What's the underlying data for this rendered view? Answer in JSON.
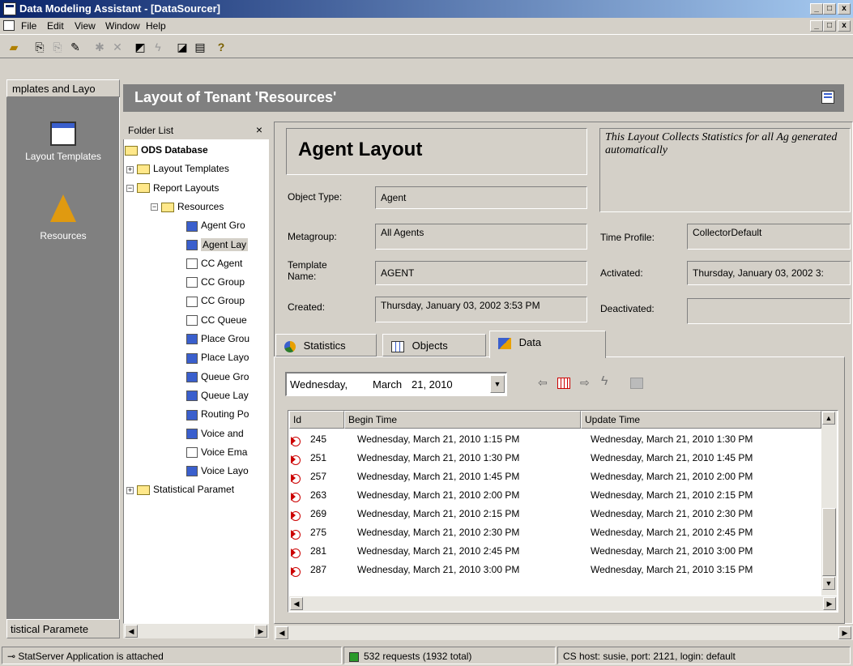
{
  "window": {
    "title": "Data Modeling Assistant - [DataSourcer]",
    "minimize": "_",
    "maximize": "□",
    "close": "x"
  },
  "menu": [
    "File",
    "Edit",
    "View",
    "Window",
    "Help"
  ],
  "left_bar": {
    "top_tab": "mplates and Layo",
    "items": [
      {
        "label": "Layout Templates",
        "icon": "window-icon"
      },
      {
        "label": "Resources",
        "icon": "resources-icon"
      }
    ],
    "bottom_tab": "tistical Paramete"
  },
  "header": {
    "title": "Layout of Tenant 'Resources'"
  },
  "folder_list": {
    "title": "Folder List",
    "close": "×",
    "nodes": [
      {
        "label": "ODS Database",
        "level": 0,
        "bold": true,
        "type": "folder"
      },
      {
        "label": "Layout Templates",
        "level": 1,
        "type": "folder",
        "exp": "+"
      },
      {
        "label": "Report Layouts",
        "level": 1,
        "type": "folder",
        "exp": "−"
      },
      {
        "label": "Resources",
        "level": 2,
        "type": "folder",
        "exp": "−"
      },
      {
        "label": "Agent Gro",
        "level": 3,
        "type": "doc-blue"
      },
      {
        "label": "Agent Lay",
        "level": 3,
        "type": "doc-blue",
        "selected": true
      },
      {
        "label": "CC Agent",
        "level": 3,
        "type": "doc"
      },
      {
        "label": "CC Group",
        "level": 3,
        "type": "doc"
      },
      {
        "label": "CC Group",
        "level": 3,
        "type": "doc"
      },
      {
        "label": "CC Queue",
        "level": 3,
        "type": "doc"
      },
      {
        "label": "Place Grou",
        "level": 3,
        "type": "doc-blue"
      },
      {
        "label": "Place Layo",
        "level": 3,
        "type": "doc-blue"
      },
      {
        "label": "Queue Gro",
        "level": 3,
        "type": "doc-blue"
      },
      {
        "label": "Queue Lay",
        "level": 3,
        "type": "doc-blue"
      },
      {
        "label": "Routing Po",
        "level": 3,
        "type": "doc-blue"
      },
      {
        "label": "Voice and",
        "level": 3,
        "type": "doc-blue"
      },
      {
        "label": "Voice Ema",
        "level": 3,
        "type": "doc"
      },
      {
        "label": "Voice Layo",
        "level": 3,
        "type": "doc-blue"
      },
      {
        "label": "Statistical Paramet",
        "level": 1,
        "type": "folder",
        "exp": "+"
      }
    ]
  },
  "detail": {
    "name": "Agent Layout",
    "description": "This Layout Collects Statistics for all Ag generated automatically",
    "object_type_label": "Object Type:",
    "object_type": "Agent",
    "metagroup_label": "Metagroup:",
    "metagroup": "All Agents",
    "template_label": "Template Name:",
    "template": "AGENT",
    "created_label": "Created:",
    "created": "Thursday, January 03, 2002 3:53 PM",
    "time_profile_label": "Time Profile:",
    "time_profile": "CollectorDefault",
    "activated_label": "Activated:",
    "activated": "Thursday, January 03, 2002 3:",
    "deactivated_label": "Deactivated:",
    "deactivated": ""
  },
  "tabs": [
    {
      "label": "Statistics",
      "icon": "pie-chart-icon"
    },
    {
      "label": "Objects",
      "icon": "grid-icon"
    },
    {
      "label": "Data",
      "icon": "data-icon",
      "active": true
    }
  ],
  "date_picker": {
    "weekday": "Wednesday,",
    "month": "March",
    "day": "21, 2010"
  },
  "grid": {
    "columns": [
      "Id",
      "Begin Time",
      "Update Time"
    ],
    "rows": [
      {
        "id": "245",
        "begin": "Wednesday, March 21, 2010 1:15 PM",
        "update": "Wednesday, March 21, 2010 1:30 PM"
      },
      {
        "id": "251",
        "begin": "Wednesday, March 21, 2010 1:30 PM",
        "update": "Wednesday, March 21, 2010 1:45 PM"
      },
      {
        "id": "257",
        "begin": "Wednesday, March 21, 2010 1:45 PM",
        "update": "Wednesday, March 21, 2010 2:00 PM"
      },
      {
        "id": "263",
        "begin": "Wednesday, March 21, 2010 2:00 PM",
        "update": "Wednesday, March 21, 2010 2:15 PM"
      },
      {
        "id": "269",
        "begin": "Wednesday, March 21, 2010 2:15 PM",
        "update": "Wednesday, March 21, 2010 2:30 PM"
      },
      {
        "id": "275",
        "begin": "Wednesday, March 21, 2010 2:30 PM",
        "update": "Wednesday, March 21, 2010 2:45 PM"
      },
      {
        "id": "281",
        "begin": "Wednesday, March 21, 2010 2:45 PM",
        "update": "Wednesday, March 21, 2010 3:00 PM"
      },
      {
        "id": "287",
        "begin": "Wednesday, March 21, 2010 3:00 PM",
        "update": "Wednesday, March 21, 2010 3:15 PM"
      }
    ]
  },
  "status": {
    "attached": "StatServer Application is attached",
    "requests": "532 requests (1932 total)",
    "host": "CS host: susie, port: 2121, login: default"
  }
}
